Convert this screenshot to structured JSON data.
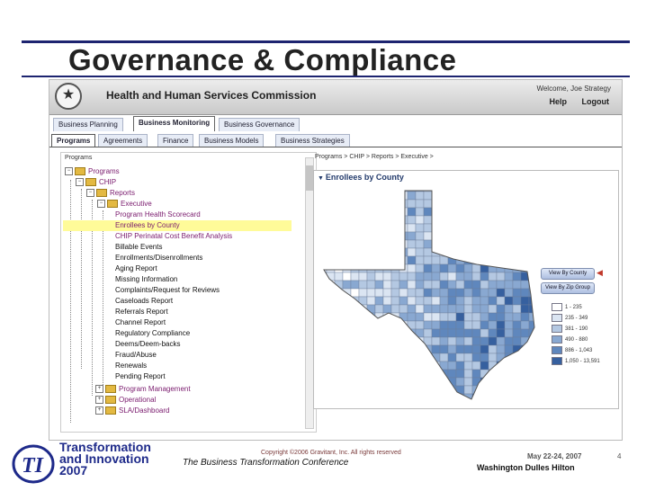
{
  "slide": {
    "title": "Governance & Compliance"
  },
  "header": {
    "org": "Health and Human Services Commission",
    "welcome": "Welcome, Joe Strategy",
    "help": "Help",
    "logout": "Logout"
  },
  "tabs": [
    "Business Planning",
    "Business Monitoring",
    "Business Governance"
  ],
  "subtabs": [
    "Programs",
    "Agreements",
    "Finance",
    "Business Models",
    "Business Strategies"
  ],
  "tree": {
    "header": "Programs",
    "nodes": [
      "Programs",
      "CHIP",
      "Reports",
      "Executive",
      "Program Health Scorecard",
      "Enrollees by County",
      "CHIP Perinatal Cost Benefit Analysis",
      "Billable Events",
      "Enrollments/Disenrollments",
      "Aging Report",
      "Missing Information",
      "Complaints/Request for Reviews",
      "Caseloads Report",
      "Referrals Report",
      "Channel Report",
      "Regulatory Compliance",
      "Deems/Deem-backs",
      "Fraud/Abuse",
      "Renewals",
      "Pending Report",
      "Program Management",
      "Operational",
      "SLA/Dashboard"
    ]
  },
  "breadcrumb": "Programs > CHIP > Reports > Executive >",
  "map": {
    "title": "Enrollees by County",
    "btn_county": "View By County",
    "btn_zip": "View By Zip Group",
    "legend": [
      "1 - 235",
      "235 - 349",
      "381 - 190",
      "490 - 880",
      "886 - 1,043",
      "1,050 - 13,591"
    ],
    "colors": [
      "#ffffff",
      "#dbe5f2",
      "#b4c8e2",
      "#89a8d1",
      "#5f87bd",
      "#36609f"
    ]
  },
  "footer": {
    "logo_line1": "Transformation",
    "logo_line2": "and Innovation",
    "logo_line3": "2007",
    "conference": "The Business Transformation Conference",
    "copyright": "Copyright ©2006 Gravitant, Inc. All rights reserved",
    "date": "May 22-24, 2007",
    "venue": "Washington Dulles Hilton",
    "page": "4"
  }
}
